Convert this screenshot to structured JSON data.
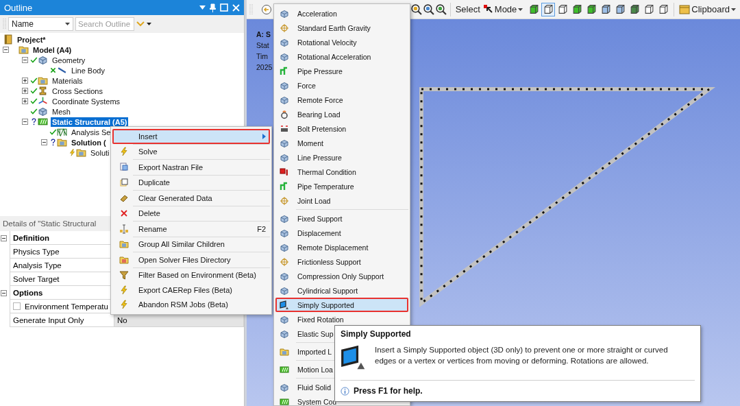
{
  "outline": {
    "title": "Outline",
    "filter": {
      "value": "Name",
      "search_placeholder": "Search Outline"
    },
    "tree": [
      {
        "label": "Project*",
        "bold": true,
        "selected": false,
        "children": [
          {
            "label": "Model (A4)",
            "bold": true,
            "selected": false,
            "expanded": true,
            "children": [
              {
                "label": "Geometry",
                "kind": "check",
                "bold": false,
                "selected": false,
                "expanded": true,
                "children": [
                  {
                    "label": "Line Body",
                    "kind": "cross",
                    "bold": false,
                    "selected": false
                  }
                ]
              },
              {
                "label": "Materials",
                "kind": "check",
                "bold": false,
                "selected": false,
                "expanded": false
              },
              {
                "label": "Cross Sections",
                "kind": "check",
                "bold": false,
                "selected": false,
                "expanded": false
              },
              {
                "label": "Coordinate Systems",
                "kind": "check",
                "bold": false,
                "selected": false,
                "expanded": false
              },
              {
                "label": "Mesh",
                "kind": "check",
                "bold": false,
                "selected": false
              },
              {
                "label": "Static Structural (A5)",
                "kind": "question",
                "bold": true,
                "selected": true,
                "expanded": true,
                "children": [
                  {
                    "label": "Analysis Se",
                    "kind": "check",
                    "bold": false,
                    "selected": false
                  },
                  {
                    "label": "Solution (",
                    "kind": "question",
                    "bold": true,
                    "selected": false,
                    "expanded": true,
                    "children": [
                      {
                        "label": "Soluti",
                        "kind": "lightning",
                        "bold": false,
                        "selected": false
                      }
                    ]
                  }
                ]
              }
            ]
          }
        ]
      }
    ]
  },
  "details": {
    "title": "Details of \"Static Structural",
    "groups": [
      {
        "label": "Definition",
        "expanded": true,
        "rows": [
          {
            "kind": "field",
            "name": "Physics Type"
          },
          {
            "kind": "field",
            "name": "Analysis Type"
          },
          {
            "kind": "field",
            "name": "Solver Target"
          }
        ]
      },
      {
        "label": "Options",
        "expanded": true,
        "rows": [
          {
            "kind": "checkbox",
            "name": "Environment Temperatu",
            "checked": false
          },
          {
            "kind": "field",
            "name": "Generate Input Only",
            "value": "No"
          }
        ]
      }
    ]
  },
  "toolbar": {
    "select_label": "Select",
    "mode_label": "Mode",
    "clipboard_label": "Clipboard",
    "view_buttons": [
      {
        "selected": false
      },
      {
        "selected": true
      },
      {
        "selected": false
      },
      {
        "selected": false
      },
      {
        "selected": false
      },
      {
        "selected": false
      },
      {
        "selected": false
      },
      {
        "selected": false
      },
      {
        "selected": false
      },
      {
        "selected": false
      }
    ]
  },
  "viewport": {
    "info_lines": [
      {
        "kind": "title",
        "text": "A: S"
      },
      {
        "kind": "line",
        "text": "Stat"
      },
      {
        "kind": "line",
        "text": "Tim"
      },
      {
        "kind": "line",
        "text": "2025"
      }
    ]
  },
  "context_menu": {
    "items": [
      {
        "kind": "item",
        "label": "Insert",
        "has_submenu": true,
        "selected": true
      },
      {
        "kind": "separator"
      },
      {
        "kind": "item",
        "label": "Solve",
        "has_submenu": false,
        "selected": false
      },
      {
        "kind": "separator"
      },
      {
        "kind": "item",
        "label": "Export Nastran File",
        "has_submenu": false,
        "selected": false
      },
      {
        "kind": "separator"
      },
      {
        "kind": "item",
        "label": "Duplicate",
        "has_submenu": false,
        "selected": false
      },
      {
        "kind": "separator"
      },
      {
        "kind": "item",
        "label": "Clear Generated Data",
        "has_submenu": false,
        "selected": false
      },
      {
        "kind": "separator"
      },
      {
        "kind": "item",
        "label": "Delete",
        "has_submenu": false,
        "selected": false
      },
      {
        "kind": "separator"
      },
      {
        "kind": "item",
        "label": "Rename",
        "shortcut": "F2",
        "has_submenu": false,
        "selected": false
      },
      {
        "kind": "separator"
      },
      {
        "kind": "item",
        "label": "Group All Similar Children",
        "has_submenu": false,
        "selected": false
      },
      {
        "kind": "separator"
      },
      {
        "kind": "item",
        "label": "Open Solver Files Directory",
        "has_submenu": false,
        "selected": false
      },
      {
        "kind": "separator"
      },
      {
        "kind": "item",
        "label": "Filter Based on Environment (Beta)",
        "has_submenu": false,
        "selected": false
      },
      {
        "kind": "item",
        "label": "Export CAERep Files (Beta)",
        "has_submenu": false,
        "selected": false
      },
      {
        "kind": "item",
        "label": "Abandon RSM Jobs (Beta)",
        "has_submenu": false,
        "selected": false
      }
    ]
  },
  "insert_menu": {
    "items": [
      {
        "kind": "item",
        "label": "Acceleration",
        "selected": false
      },
      {
        "kind": "item",
        "label": "Standard Earth Gravity",
        "selected": false
      },
      {
        "kind": "item",
        "label": "Rotational Velocity",
        "selected": false
      },
      {
        "kind": "item",
        "label": "Rotational Acceleration",
        "selected": false
      },
      {
        "kind": "item",
        "label": "Pipe Pressure",
        "selected": false
      },
      {
        "kind": "item",
        "label": "Force",
        "selected": false
      },
      {
        "kind": "item",
        "label": "Remote Force",
        "selected": false
      },
      {
        "kind": "item",
        "label": "Bearing Load",
        "selected": false
      },
      {
        "kind": "item",
        "label": "Bolt Pretension",
        "selected": false
      },
      {
        "kind": "item",
        "label": "Moment",
        "selected": false
      },
      {
        "kind": "item",
        "label": "Line Pressure",
        "selected": false
      },
      {
        "kind": "item",
        "label": "Thermal Condition",
        "selected": false
      },
      {
        "kind": "item",
        "label": "Pipe Temperature",
        "selected": false
      },
      {
        "kind": "item",
        "label": "Joint Load",
        "selected": false
      },
      {
        "kind": "separator"
      },
      {
        "kind": "item",
        "label": "Fixed Support",
        "selected": false
      },
      {
        "kind": "item",
        "label": "Displacement",
        "selected": false
      },
      {
        "kind": "item",
        "label": "Remote Displacement",
        "selected": false
      },
      {
        "kind": "item",
        "label": "Frictionless Support",
        "selected": false
      },
      {
        "kind": "item",
        "label": "Compression Only Support",
        "selected": false
      },
      {
        "kind": "item",
        "label": "Cylindrical Support",
        "selected": false
      },
      {
        "kind": "item",
        "label": "Simply Supported",
        "selected": true
      },
      {
        "kind": "item",
        "label": "Fixed Rotation",
        "selected": false
      },
      {
        "kind": "item",
        "label": "Elastic Sup",
        "selected": false
      },
      {
        "kind": "separator"
      },
      {
        "kind": "item",
        "label": "Imported L",
        "selected": false
      },
      {
        "kind": "separator"
      },
      {
        "kind": "item",
        "label": "Motion Loa",
        "selected": false
      },
      {
        "kind": "separator"
      },
      {
        "kind": "item",
        "label": "Fluid Solid",
        "selected": false
      },
      {
        "kind": "item",
        "label": "System Cou",
        "selected": false
      }
    ]
  },
  "tooltip": {
    "title": "Simply Supported",
    "body": "Insert a Simply Supported object (3D only) to prevent one or more straight or curved edges or a vertex or vertices from moving or deforming. Rotations are allowed.",
    "help": "Press F1 for help."
  }
}
